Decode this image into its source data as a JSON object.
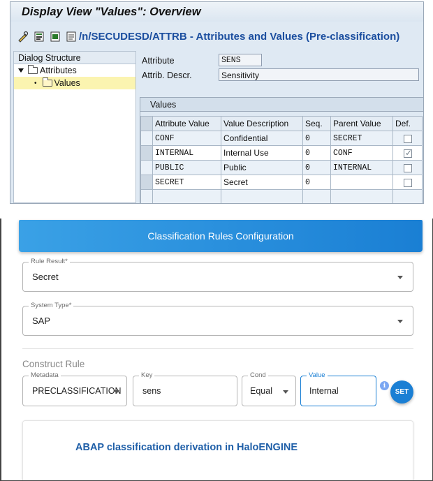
{
  "sap": {
    "title": "Display View \"Values\": Overview",
    "tcode": "/n/SECUDESD/ATTRB -  Attributes and Values (Pre-classification)",
    "toolbar_icons": [
      "edit-glasses-icon",
      "save-icon",
      "select-all-icon",
      "deselect-icon"
    ],
    "dialog_structure": {
      "header": "Dialog Structure",
      "items": [
        {
          "label": "Attributes",
          "level": 0,
          "expanded": true,
          "selected": false
        },
        {
          "label": "Values",
          "level": 1,
          "expanded": false,
          "selected": true
        }
      ]
    },
    "form": {
      "attribute_label": "Attribute",
      "attribute_value": "SENS",
      "descr_label": "Attrib. Descr.",
      "descr_value": "Sensitivity"
    },
    "values_table": {
      "title": "Values",
      "columns": [
        "Attribute Value",
        "Value Description",
        "Seq.",
        "Parent Value",
        "Def."
      ],
      "rows": [
        {
          "attr": "CONF",
          "desc": "Confidential",
          "seq": "0",
          "parent": "SECRET",
          "def": false
        },
        {
          "attr": "INTERNAL",
          "desc": "Internal Use",
          "seq": "0",
          "parent": "CONF",
          "def": true
        },
        {
          "attr": "PUBLIC",
          "desc": "Public",
          "seq": "0",
          "parent": "INTERNAL",
          "def": false
        },
        {
          "attr": "SECRET",
          "desc": "Secret",
          "seq": "0",
          "parent": "",
          "def": false
        }
      ]
    }
  },
  "classification": {
    "header_title": "Classification Rules Configuration",
    "rule_result": {
      "label": "Rule Result*",
      "value": "Secret"
    },
    "system_type": {
      "label": "System Type*",
      "value": "SAP"
    },
    "construct_rule": {
      "title": "Construct Rule",
      "metadata": {
        "label": "Metadata",
        "value": "PRECLASSIFICATION"
      },
      "key": {
        "label": "Key",
        "value": "sens"
      },
      "cond": {
        "label": "Cond",
        "value": "Equal"
      },
      "value": {
        "label": "Value",
        "value": "Internal"
      },
      "info_glyph": "i",
      "set_label": "SET"
    },
    "card_text": "ABAP classification derivation in HaloENGINE"
  },
  "colors": {
    "sap_link_blue": "#1b4e9f",
    "header_blue": "#1a7fd4",
    "card_text_blue": "#1f5fa8",
    "tree_selected": "#fbf4b0"
  }
}
